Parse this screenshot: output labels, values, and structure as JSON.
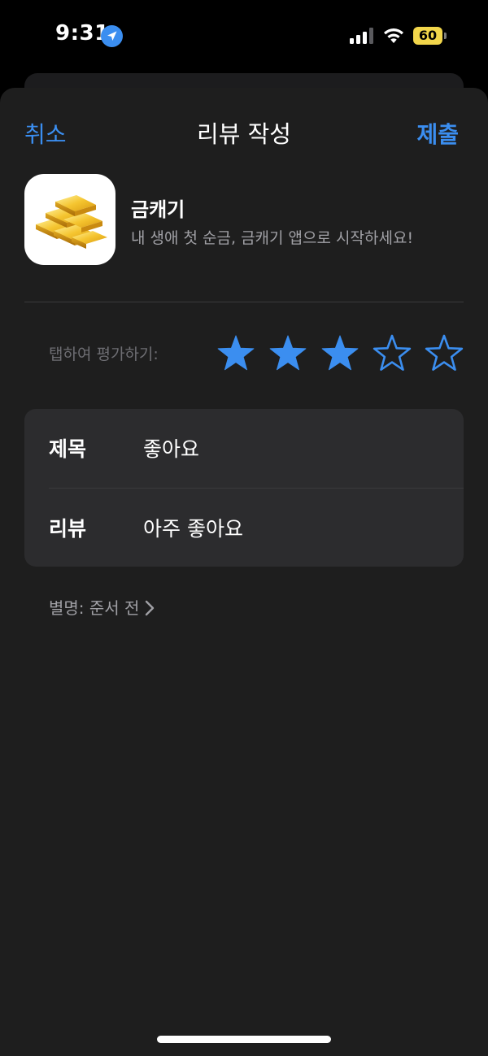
{
  "status_bar": {
    "time": "9:31",
    "battery_percent": "60",
    "battery_color": "#f2d64b",
    "signal_bars_active": 3,
    "signal_bars_total": 4,
    "icons": [
      "location-arrow-icon",
      "cellular-signal-icon",
      "wifi-icon",
      "battery-icon"
    ]
  },
  "nav": {
    "cancel_label": "취소",
    "title": "리뷰 작성",
    "submit_label": "제출",
    "accent_color": "#3b8ef0"
  },
  "app": {
    "name": "금캐기",
    "subtitle": "내 생애 첫 순금, 금캐기 앱으로 시작하세요!",
    "icon": "gold-bars-icon"
  },
  "rating": {
    "label": "탭하여 평가하기:",
    "value": 3,
    "max": 5,
    "star_color": "#3b8ef0"
  },
  "form": {
    "title_label": "제목",
    "title_value": "좋아요",
    "review_label": "리뷰",
    "review_value": "아주 좋아요"
  },
  "nickname": {
    "text": "별명: 준서 전"
  }
}
